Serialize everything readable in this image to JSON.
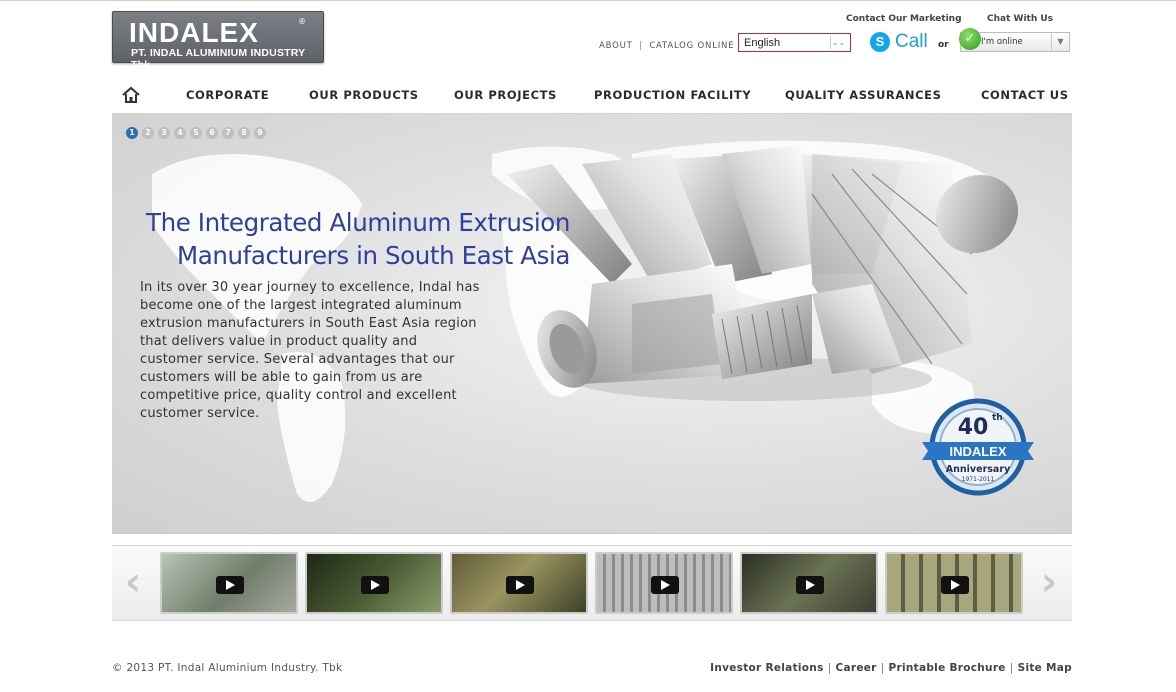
{
  "header": {
    "logo": {
      "brand": "INDALEX",
      "company": "PT. INDAL ALUMINIUM INDUSTRY Tbk."
    },
    "contact_marketing": "Contact Our Marketing",
    "chat_with_us": "Chat With Us",
    "links": {
      "about": "ABOUT",
      "catalog": "CATALOG ONLINE"
    },
    "language": "English",
    "call_label": "Call",
    "or_label": "or",
    "online_status": "I'm online"
  },
  "nav": {
    "items": [
      "CORPORATE",
      "OUR PRODUCTS",
      "OUR PROJECTS",
      "PRODUCTION FACILITY",
      "QUALITY ASSURANCES",
      "CONTACT US"
    ]
  },
  "hero": {
    "slides": [
      "1",
      "2",
      "3",
      "4",
      "5",
      "6",
      "7",
      "8",
      "9"
    ],
    "active_slide": "1",
    "title_line1": "The Integrated Aluminum Extrusion",
    "title_line2": "Manufacturers in South East Asia",
    "body": "In its over 30 year journey to excellence, Indal has become one of the largest integrated aluminum extrusion manufacturers in South East Asia region that delivers value in product quality and customer service. Several advantages that our customers will be able to gain from us are competitive price, quality control and excellent customer service.",
    "badge": {
      "years": "40",
      "suffix": "th",
      "brand": "INDALEX",
      "label": "Anniversary",
      "range": "1971-2011"
    }
  },
  "videos": {
    "thumbnails": [
      {
        "name": "video-1",
        "color": "#8a9a88"
      },
      {
        "name": "video-2",
        "color": "#3d4b2c"
      },
      {
        "name": "video-3",
        "color": "#7a7a52"
      },
      {
        "name": "video-4",
        "color": "#9c9c9c"
      },
      {
        "name": "video-5",
        "color": "#4a5140"
      },
      {
        "name": "video-6",
        "color": "#8e8f6a"
      }
    ]
  },
  "footer": {
    "copyright": "© 2013 PT. Indal Aluminium Industry. Tbk",
    "links": [
      "Investor Relations",
      "Career",
      "Printable Brochure",
      "Site Map"
    ]
  },
  "colors": {
    "accent": "#2e3f9e",
    "skype": "#1e9fe0",
    "brand_red": "#d8262c"
  }
}
